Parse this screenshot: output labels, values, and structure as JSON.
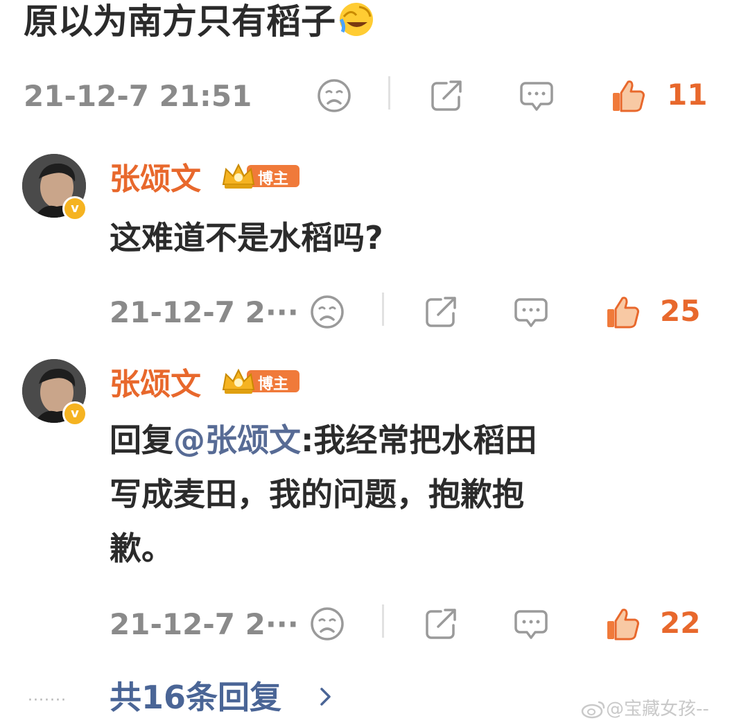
{
  "post": {
    "text": "原以为南方只有稻子",
    "emoji": "face-with-tears-of-joy-icon",
    "timestamp": "21-12-7 21:51",
    "like_count": "11"
  },
  "replies": [
    {
      "author": "张颂文",
      "badge": "博主",
      "text": "这难道不是水稻吗?",
      "timestamp": "21-12-7 2···",
      "like_count": "25"
    },
    {
      "author": "张颂文",
      "badge": "博主",
      "reply_prefix": "回复",
      "mention": "@张颂文",
      "text_line1": ":我经常把水稻田",
      "text_line2": "写成麦田，我的问题，抱歉抱",
      "text_line3": "歉。",
      "timestamp": "21-12-7 2···",
      "like_count": "22"
    }
  ],
  "footer": {
    "dots": "·······",
    "reply_link": "共16条回复",
    "watermark": "@宝藏女孩--"
  },
  "colors": {
    "accent": "#e8682c",
    "mention": "#576b95",
    "muted": "#8a8a8a",
    "verified": "#f5b321"
  },
  "icons": [
    "sad-face-icon",
    "share-icon",
    "comment-icon",
    "thumbs-up-icon",
    "crown-icon",
    "chevron-right-icon",
    "weibo-logo-icon"
  ]
}
